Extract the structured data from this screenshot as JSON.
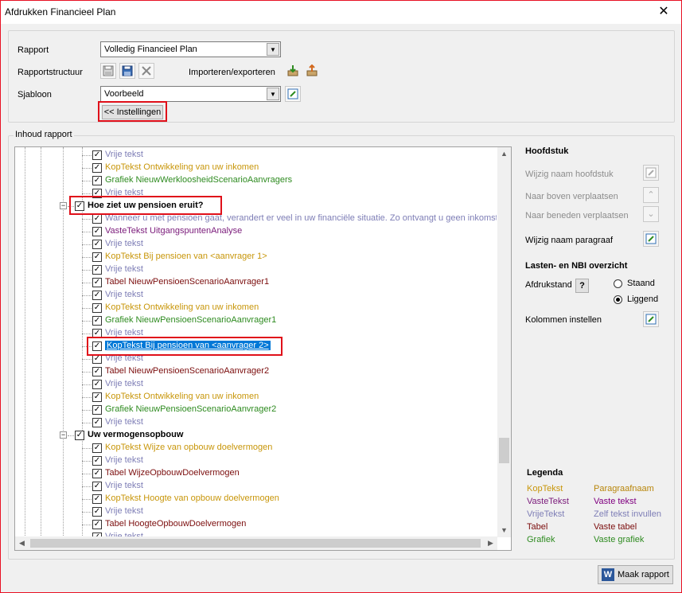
{
  "window": {
    "title": "Afdrukken Financieel Plan",
    "close_glyph": "✕"
  },
  "top": {
    "rapport_label": "Rapport",
    "rapport_value": "Volledig Financieel Plan",
    "rapportstructuur_label": "Rapportstructuur",
    "importeren_label": "Importeren/exporteren",
    "sjabloon_label": "Sjabloon",
    "sjabloon_value": "Voorbeeld",
    "instellingen_button": "<< Instellingen"
  },
  "inhoud": {
    "legend": "Inhoud rapport"
  },
  "tree": {
    "nodes": [
      {
        "text": "Vrije tekst",
        "color": "vrij"
      },
      {
        "text": "KopTekst Ontwikkeling van uw inkomen",
        "color": "kop"
      },
      {
        "text": "Grafiek NieuwWerkloosheidScenarioAanvragers",
        "color": "graf"
      },
      {
        "text": "Vrije tekst",
        "color": "vrij"
      },
      {
        "text": "Hoe ziet uw pensioen eruit?",
        "color": "chapter"
      },
      {
        "text": "Wanneer u met pensioen gaat, verandert er veel in uw financiële situatie. Zo ontvangt u geen inkomste",
        "color": "vrij"
      },
      {
        "text": "VasteTekst UitgangspuntenAnalyse",
        "color": "vast"
      },
      {
        "text": "Vrije tekst",
        "color": "vrij"
      },
      {
        "text": "KopTekst Bij pensioen van <aanvrager 1>",
        "color": "kop"
      },
      {
        "text": "Vrije tekst",
        "color": "vrij"
      },
      {
        "text": "Tabel NieuwPensioenScenarioAanvrager1",
        "color": "tabel"
      },
      {
        "text": "Vrije tekst",
        "color": "vrij"
      },
      {
        "text": "KopTekst Ontwikkeling van uw inkomen",
        "color": "kop"
      },
      {
        "text": "Grafiek NieuwPensioenScenarioAanvrager1",
        "color": "graf"
      },
      {
        "text": "Vrije tekst",
        "color": "vrij"
      },
      {
        "text": "KopTekst Bij pensioen van <aanvrager 2>",
        "color": "sel"
      },
      {
        "text": "Vrije tekst",
        "color": "vrij"
      },
      {
        "text": "Tabel NieuwPensioenScenarioAanvrager2",
        "color": "tabel"
      },
      {
        "text": "Vrije tekst",
        "color": "vrij"
      },
      {
        "text": "KopTekst Ontwikkeling van uw inkomen",
        "color": "kop"
      },
      {
        "text": "Grafiek NieuwPensioenScenarioAanvrager2",
        "color": "graf"
      },
      {
        "text": "Vrije tekst",
        "color": "vrij"
      },
      {
        "text": "Uw vermogensopbouw",
        "color": "chapter"
      },
      {
        "text": "KopTekst Wijze van opbouw doelvermogen",
        "color": "kop"
      },
      {
        "text": "Vrije tekst",
        "color": "vrij"
      },
      {
        "text": "Tabel WijzeOpbouwDoelvermogen",
        "color": "tabel"
      },
      {
        "text": "Vrije tekst",
        "color": "vrij"
      },
      {
        "text": "KopTekst Hoogte van opbouw doelvermogen",
        "color": "kop"
      },
      {
        "text": "Vrije tekst",
        "color": "vrij"
      },
      {
        "text": "Tabel HoogteOpbouwDoelvermogen",
        "color": "tabel"
      },
      {
        "text": "Vrije tekst",
        "color": "vrij"
      }
    ]
  },
  "right": {
    "hoofdstuk_title": "Hoofdstuk",
    "wijzig_hoofdstuk": "Wijzig naam hoofdstuk",
    "naar_boven": "Naar boven verplaatsen",
    "naar_beneden": "Naar beneden verplaatsen",
    "wijzig_paragraaf": "Wijzig naam paragraaf",
    "lasten_title": "Lasten- en NBI overzicht",
    "afdrukstand_label": "Afdrukstand",
    "help_glyph": "?",
    "staand": "Staand",
    "liggend": "Liggend",
    "kolommen": "Kolommen instellen"
  },
  "legenda": {
    "title": "Legenda",
    "left": [
      "KopTekst",
      "VasteTekst",
      "VrijeTekst",
      "Tabel",
      "Grafiek"
    ],
    "right": [
      "Paragraafnaam",
      "Vaste tekst",
      "Zelf tekst invullen",
      "Vaste tabel",
      "Vaste grafiek"
    ]
  },
  "footer": {
    "maak_rapport_icon": "W",
    "maak_rapport": "Maak rapport"
  },
  "colors": {
    "kop": "#c8960a",
    "vast": "#800080",
    "vrij": "#7e7eb6",
    "tabel": "#7b0d0d",
    "graf": "#2e8b20",
    "highlight": "#e0101a",
    "selection": "#0078d7"
  }
}
